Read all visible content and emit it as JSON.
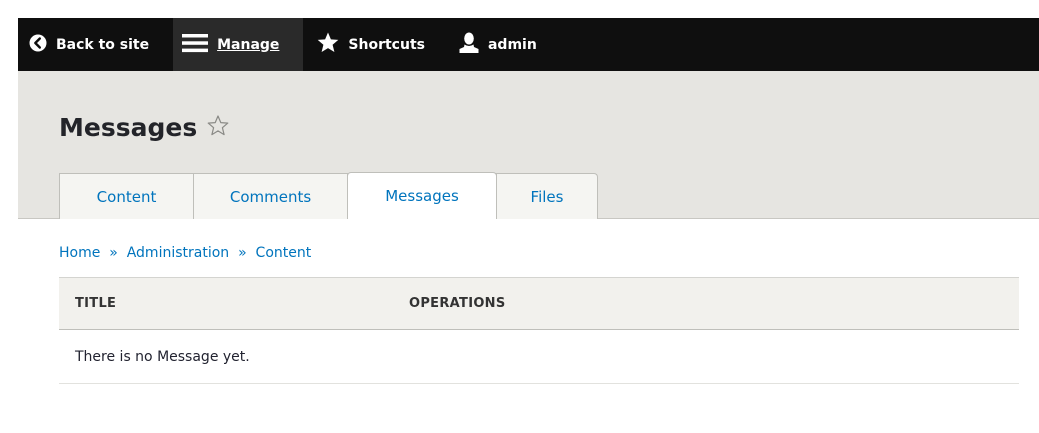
{
  "toolbar": {
    "back_label": "Back to site",
    "manage_label": "Manage",
    "shortcuts_label": "Shortcuts",
    "user_label": "admin"
  },
  "header": {
    "title": "Messages"
  },
  "tabs": [
    {
      "label": "Content"
    },
    {
      "label": "Comments"
    },
    {
      "label": "Messages",
      "active": true
    },
    {
      "label": "Files"
    }
  ],
  "breadcrumb": {
    "items": [
      "Home",
      "Administration",
      "Content"
    ],
    "separator": "»"
  },
  "table": {
    "columns": [
      "TITLE",
      "OPERATIONS"
    ],
    "empty_text": "There is no Message yet."
  },
  "colors": {
    "toolbar_bg": "#0f0f0f",
    "header_bg": "#e6e5e1",
    "link": "#0074bd"
  }
}
